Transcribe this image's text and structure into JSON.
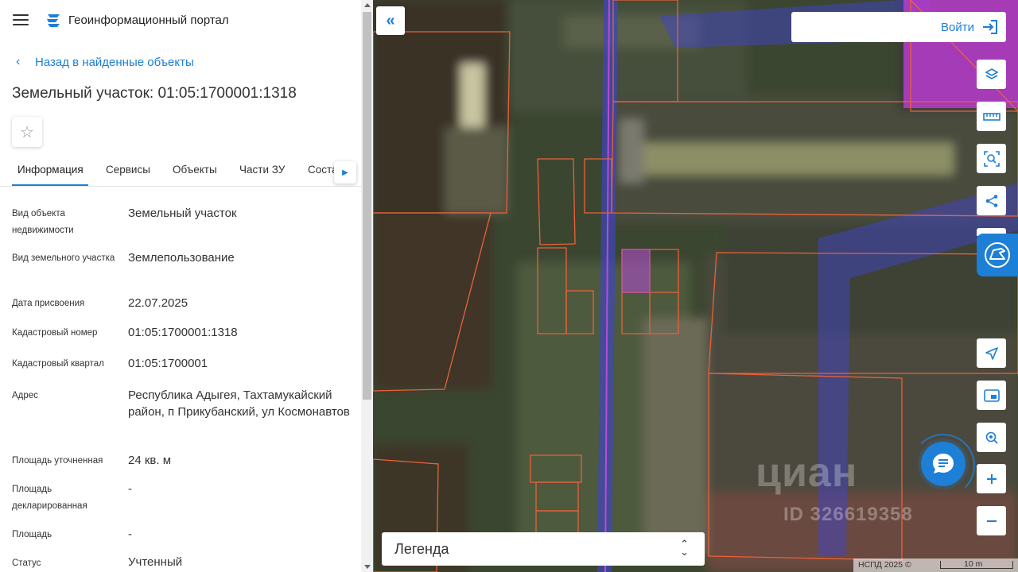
{
  "header": {
    "portal_title": "Геоинформационный портал"
  },
  "nav": {
    "back_label": "Назад в найденные объекты"
  },
  "object": {
    "title": "Земельный участок: 01:05:1700001:1318"
  },
  "tabs": [
    {
      "label": "Информация",
      "active": true
    },
    {
      "label": "Сервисы"
    },
    {
      "label": "Объекты"
    },
    {
      "label": "Части ЗУ"
    },
    {
      "label": "Соста"
    }
  ],
  "info_rows": [
    {
      "label": "Вид объекта недвижимости",
      "value": "Земельный участок"
    },
    {
      "label": "Вид земельного участка",
      "value": "Землепользование"
    },
    {
      "label": "Дата присвоения",
      "value": "22.07.2025"
    },
    {
      "label": "Кадастровый номер",
      "value": "01:05:1700001:1318"
    },
    {
      "label": "Кадастровый квартал",
      "value": "01:05:1700001"
    },
    {
      "label": "Адрес",
      "value": "Республика Адыгея, Тахтамукайский район, п Прикубанский, ул Космонавтов"
    },
    {
      "label": "Площадь уточненная",
      "value": "24 кв. м"
    },
    {
      "label": "Площадь декларированная",
      "value": "-"
    },
    {
      "label": "Площадь",
      "value": "-"
    },
    {
      "label": "Статус",
      "value": "Учтенный"
    }
  ],
  "map": {
    "login_label": "Войти",
    "legend_label": "Легенда",
    "attribution": "НСПД 2025 ©",
    "scale_label": "10 m",
    "watermark_brand": "циан",
    "watermark_id": "ID 326619358",
    "accent_color": "#1e7fd6"
  }
}
